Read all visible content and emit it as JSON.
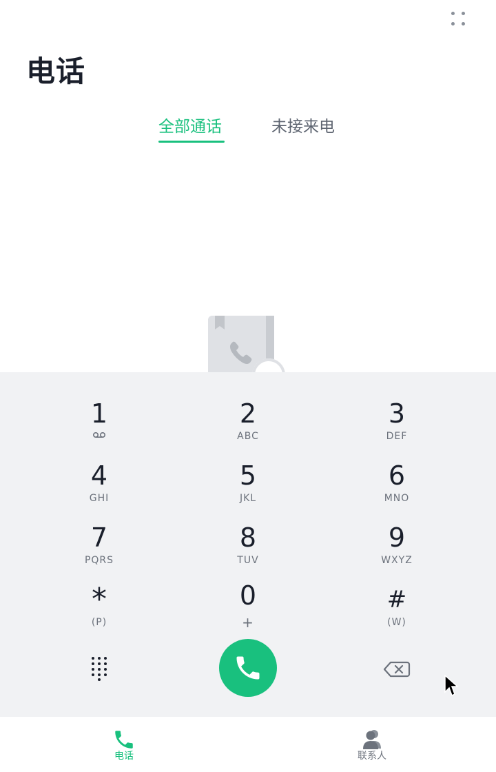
{
  "app": {
    "title": "电话"
  },
  "header": {
    "more_icon": "more-dots-icon"
  },
  "tabs": [
    {
      "label": "全部通话",
      "active": true
    },
    {
      "label": "未接来电",
      "active": false
    }
  ],
  "empty_state": {
    "icon": "call-log-empty-illustration"
  },
  "dialpad": {
    "keys": [
      {
        "digit": "1",
        "sub": "",
        "icon": "voicemail-icon"
      },
      {
        "digit": "2",
        "sub": "ABC"
      },
      {
        "digit": "3",
        "sub": "DEF"
      },
      {
        "digit": "4",
        "sub": "GHI"
      },
      {
        "digit": "5",
        "sub": "JKL"
      },
      {
        "digit": "6",
        "sub": "MNO"
      },
      {
        "digit": "7",
        "sub": "PQRS"
      },
      {
        "digit": "8",
        "sub": "TUV"
      },
      {
        "digit": "9",
        "sub": "WXYZ"
      },
      {
        "digit": "*",
        "sub": "(P)"
      },
      {
        "digit": "0",
        "sub": "+"
      },
      {
        "digit": "#",
        "sub": "(W)"
      }
    ],
    "toggle_icon": "dialpad-toggle-icon",
    "call_icon": "phone-call-icon",
    "backspace_icon": "backspace-icon"
  },
  "bottom_nav": [
    {
      "label": "电话",
      "icon": "phone-icon",
      "active": true
    },
    {
      "label": "联系人",
      "icon": "contacts-icon",
      "active": false
    }
  ],
  "colors": {
    "accent": "#19c07e",
    "text_primary": "#1a1f2b",
    "text_secondary": "#6c727c",
    "dialpad_bg": "#f1f2f4"
  }
}
